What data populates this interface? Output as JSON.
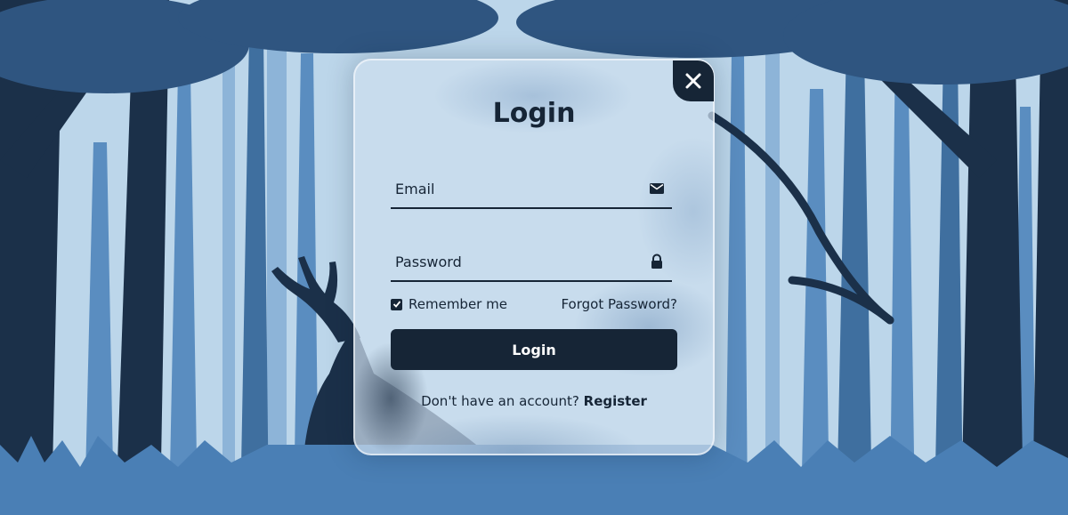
{
  "login": {
    "title": "Login",
    "email_placeholder": "Email",
    "password_placeholder": "Password",
    "remember_label": "Remember me",
    "remember_checked": true,
    "forgot_label": "Forgot Password?",
    "submit_label": "Login",
    "register_prompt": "Don't have an account?",
    "register_link": "Register"
  },
  "icons": {
    "close": "close-icon",
    "email": "envelope-icon",
    "password": "lock-icon",
    "checkbox": "checkmark-icon"
  },
  "colors": {
    "dark": "#162536",
    "sky": "#bcd6ea",
    "tree_mid": "#4a7fb5",
    "tree_light": "#7aa6cf",
    "tree_dark": "#1e3450"
  }
}
